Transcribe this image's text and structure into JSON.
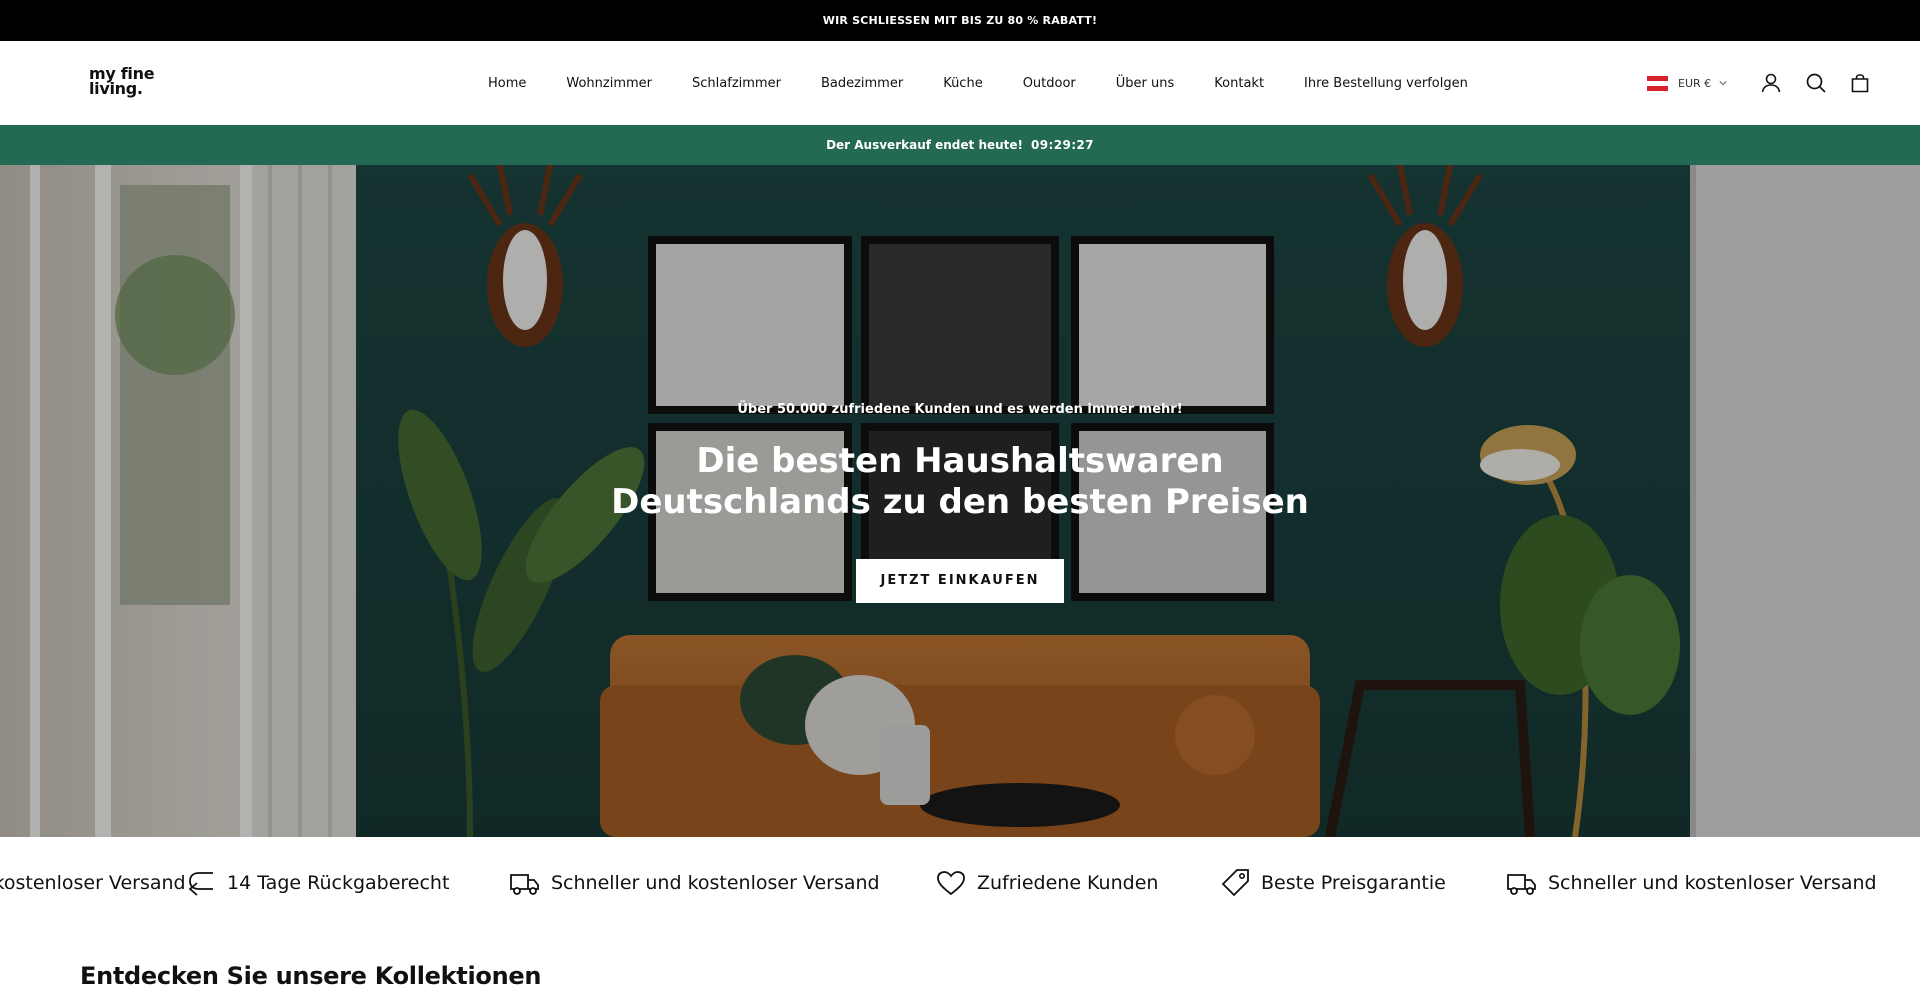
{
  "announcement": "WIR SCHLIESSEN MIT BIS ZU 80 % RABATT!",
  "logo": {
    "line1": "my fine",
    "line2": "living."
  },
  "nav": [
    "Home",
    "Wohnzimmer",
    "Schlafzimmer",
    "Badezimmer",
    "Küche",
    "Outdoor",
    "Über uns",
    "Kontakt",
    "Ihre Bestellung verfolgen"
  ],
  "header": {
    "currency": "EUR €",
    "icons": [
      "account-icon",
      "search-icon",
      "cart-icon"
    ]
  },
  "sale_bar": {
    "text": "Der Ausverkauf endet heute!",
    "timer": "09:29:27"
  },
  "hero": {
    "subtitle": "Über 50.000 zufriedene Kunden und es werden immer mehr!",
    "title": "Die besten Haushaltswaren Deutschlands zu den besten Preisen",
    "cta": "JETZT EINKAUFEN"
  },
  "marquee": [
    {
      "icon": "truck-icon",
      "text": "Schneller und kostenloser Versand"
    },
    {
      "icon": "return-arrow-icon",
      "text": "14 Tage Rückgaberecht"
    },
    {
      "icon": "truck-icon",
      "text": "Schneller und kostenloser Versand"
    },
    {
      "icon": "heart-icon",
      "text": "Zufriedene Kunden"
    },
    {
      "icon": "price-tag-icon",
      "text": "Beste Preisgarantie"
    },
    {
      "icon": "truck-icon",
      "text": "Schneller und kostenloser Versand"
    }
  ],
  "collections_title": "Entdecken Sie unsere Kollektionen",
  "colors": {
    "sale_bar": "#236953",
    "announcement": "#000000",
    "wall": "#1f4a46",
    "sofa": "#b76a2c"
  }
}
